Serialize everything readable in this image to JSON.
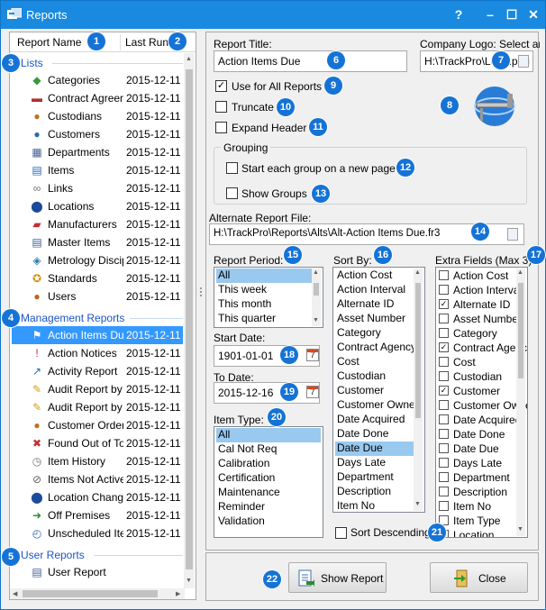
{
  "window": {
    "title": "Reports",
    "help": "?",
    "minimize": "–",
    "maximize": "☐",
    "close": "✕"
  },
  "left": {
    "headers": {
      "name": "Report Name",
      "last_run": "Last Run"
    },
    "groups": {
      "lists": "Lists",
      "management": "Management Reports",
      "user": "User Reports"
    },
    "lists": [
      {
        "name": "Categories",
        "date": "2015-12-11",
        "icon": "categories-icon"
      },
      {
        "name": "Contract Agreements",
        "date": "2015-12-11",
        "icon": "contract-icon"
      },
      {
        "name": "Custodians",
        "date": "2015-12-11",
        "icon": "custodian-icon"
      },
      {
        "name": "Customers",
        "date": "2015-12-11",
        "icon": "customers-icon"
      },
      {
        "name": "Departments",
        "date": "2015-12-11",
        "icon": "departments-icon"
      },
      {
        "name": "Items",
        "date": "2015-12-11",
        "icon": "items-icon"
      },
      {
        "name": "Links",
        "date": "2015-12-11",
        "icon": "links-icon"
      },
      {
        "name": "Locations",
        "date": "2015-12-11",
        "icon": "locations-icon"
      },
      {
        "name": "Manufacturers",
        "date": "2015-12-11",
        "icon": "manufacturers-icon"
      },
      {
        "name": "Master Items",
        "date": "2015-12-11",
        "icon": "master-items-icon"
      },
      {
        "name": "Metrology Disciplines",
        "date": "2015-12-11",
        "icon": "metrology-icon"
      },
      {
        "name": "Standards",
        "date": "2015-12-11",
        "icon": "standards-icon"
      },
      {
        "name": "Users",
        "date": "2015-12-11",
        "icon": "users-icon"
      }
    ],
    "management": [
      {
        "name": "Action Items Due",
        "date": "2015-12-11",
        "icon": "flag-icon"
      },
      {
        "name": "Action Notices",
        "date": "2015-12-11",
        "icon": "notice-icon"
      },
      {
        "name": "Activity Report",
        "date": "2015-12-11",
        "icon": "activity-icon"
      },
      {
        "name": "Audit Report by Date",
        "date": "2015-12-11",
        "icon": "audit-icon"
      },
      {
        "name": "Audit Report by Item",
        "date": "2015-12-11",
        "icon": "audit-icon"
      },
      {
        "name": "Customer Orders",
        "date": "2015-12-11",
        "icon": "customer-icon"
      },
      {
        "name": "Found Out of Tolerance",
        "date": "2015-12-11",
        "icon": "tolerance-icon"
      },
      {
        "name": "Item History",
        "date": "2015-12-11",
        "icon": "history-icon"
      },
      {
        "name": "Items Not Active",
        "date": "2015-12-11",
        "icon": "inactive-icon"
      },
      {
        "name": "Location Changes",
        "date": "2015-12-11",
        "icon": "location-change-icon"
      },
      {
        "name": "Off Premises",
        "date": "2015-12-11",
        "icon": "off-premises-icon"
      },
      {
        "name": "Unscheduled Items",
        "date": "2015-12-11",
        "icon": "unscheduled-icon"
      }
    ],
    "user": [
      {
        "name": "User Report",
        "icon": "user-report-icon"
      }
    ]
  },
  "form": {
    "report_title_label": "Report Title:",
    "report_title_value": "Action Items Due",
    "logo_label": "Company Logo: Select an",
    "logo_value": "H:\\TrackPro\\Logo.png",
    "use_all_label": "Use for All Reports",
    "use_all_checked": true,
    "truncate_label": "Truncate",
    "truncate_checked": false,
    "expand_label": "Expand Header",
    "expand_checked": false,
    "grouping_label": "Grouping",
    "new_page_label": "Start each group on a new page",
    "show_groups_label": "Show Groups",
    "alt_file_label": "Alternate Report File:",
    "alt_file_value": "H:\\TrackPro\\Reports\\Alts\\Alt-Action Items Due.fr3",
    "period_label": "Report Period:",
    "periods": [
      "All",
      "This week",
      "This month",
      "This quarter"
    ],
    "start_label": "Start Date:",
    "start_value": "1901-01-01",
    "to_label": "To Date:",
    "to_value": "2015-12-16",
    "item_type_label": "Item Type:",
    "item_types": [
      "All",
      "Cal Not Req",
      "Calibration",
      "Certification",
      "Maintenance",
      "Reminder",
      "Validation"
    ],
    "sort_label": "Sort By:",
    "sort_options": [
      "Action Cost",
      "Action Interval",
      "Alternate ID",
      "Asset Number",
      "Category",
      "Contract Agency",
      "Cost",
      "Custodian",
      "Customer",
      "Customer Owner",
      "Date Acquired",
      "Date Done",
      "Date Due",
      "Days Late",
      "Department",
      "Description",
      "Item No"
    ],
    "sort_selected": "Date Due",
    "sort_desc_label": "Sort Descending",
    "extra_label": "Extra Fields (Max 3):",
    "extra_fields": [
      {
        "name": "Action Cost",
        "checked": false
      },
      {
        "name": "Action Interval",
        "checked": false
      },
      {
        "name": "Alternate ID",
        "checked": true
      },
      {
        "name": "Asset Number",
        "checked": false
      },
      {
        "name": "Category",
        "checked": false
      },
      {
        "name": "Contract Agency",
        "checked": true
      },
      {
        "name": "Cost",
        "checked": false
      },
      {
        "name": "Custodian",
        "checked": false
      },
      {
        "name": "Customer",
        "checked": true
      },
      {
        "name": "Customer Owner",
        "checked": false
      },
      {
        "name": "Date Acquired",
        "checked": false
      },
      {
        "name": "Date Done",
        "checked": false
      },
      {
        "name": "Date Due",
        "checked": false
      },
      {
        "name": "Days Late",
        "checked": false
      },
      {
        "name": "Department",
        "checked": false
      },
      {
        "name": "Description",
        "checked": false
      },
      {
        "name": "Item No",
        "checked": false
      },
      {
        "name": "Item Type",
        "checked": false
      },
      {
        "name": "Location",
        "checked": false
      }
    ]
  },
  "buttons": {
    "show": "Show Report",
    "close": "Close"
  },
  "markers": [
    "1",
    "2",
    "3",
    "4",
    "5",
    "6",
    "7",
    "8",
    "9",
    "10",
    "11",
    "12",
    "13",
    "14",
    "15",
    "16",
    "17",
    "18",
    "19",
    "20",
    "21",
    "22"
  ],
  "colors": {
    "titlebar": "#1a8ae0",
    "marker": "#1573d6",
    "selection": "#3399ff",
    "group_text": "#1c55c6"
  }
}
